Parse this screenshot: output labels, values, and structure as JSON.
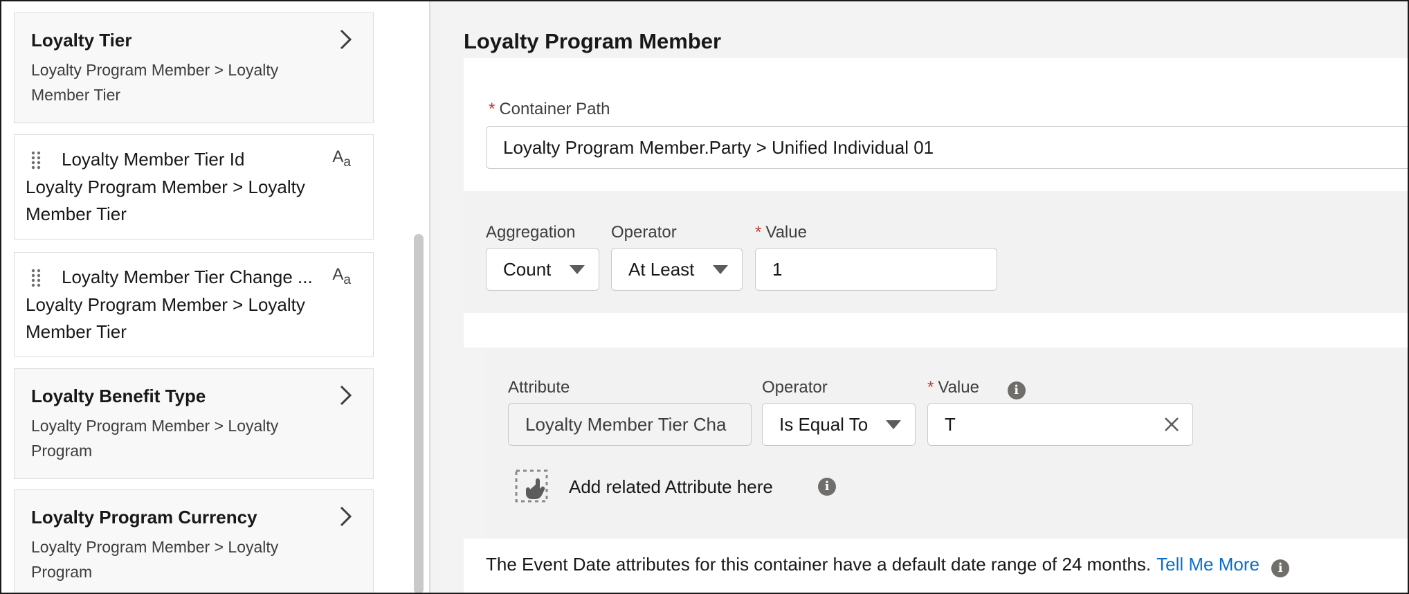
{
  "sidebar": {
    "groups": [
      {
        "title": "Loyalty Tier",
        "path": "Loyalty Program Member > Loyalty Member Tier"
      },
      {
        "title": "Loyalty Benefit Type",
        "path": "Loyalty Program Member > Loyalty Program"
      },
      {
        "title": "Loyalty Program Currency",
        "path": "Loyalty Program Member > Loyalty Program"
      }
    ],
    "attributes": [
      {
        "name": "Loyalty Member Tier Id",
        "path": "Loyalty Program Member > Loyalty Member Tier",
        "type_icon_a": "A",
        "type_icon_b": "a"
      },
      {
        "name": "Loyalty Member Tier Change ...",
        "path": "Loyalty Program Member > Loyalty Member Tier",
        "type_icon_a": "A",
        "type_icon_b": "a"
      }
    ]
  },
  "main": {
    "title": "Loyalty Program Member",
    "container_path": {
      "required_mark": "*",
      "label": "Container Path",
      "value": "Loyalty Program Member.Party > Unified Individual 01"
    },
    "aggregation": {
      "label": "Aggregation",
      "value": "Count"
    },
    "operator": {
      "label": "Operator",
      "value": "At Least"
    },
    "value": {
      "required_mark": "*",
      "label": "Value",
      "value": "1"
    },
    "attribute_row": {
      "attribute_label": "Attribute",
      "attribute_value": "Loyalty Member Tier Cha",
      "operator_label": "Operator",
      "operator_value": "Is Equal To",
      "value_required_mark": "*",
      "value_label": "Value",
      "value_value": "T",
      "info": "i"
    },
    "add_related": "Add related Attribute here",
    "note": "The Event Date attributes for this container have a default date range of 24 months.",
    "tell_more": "Tell Me More",
    "info": "i"
  }
}
